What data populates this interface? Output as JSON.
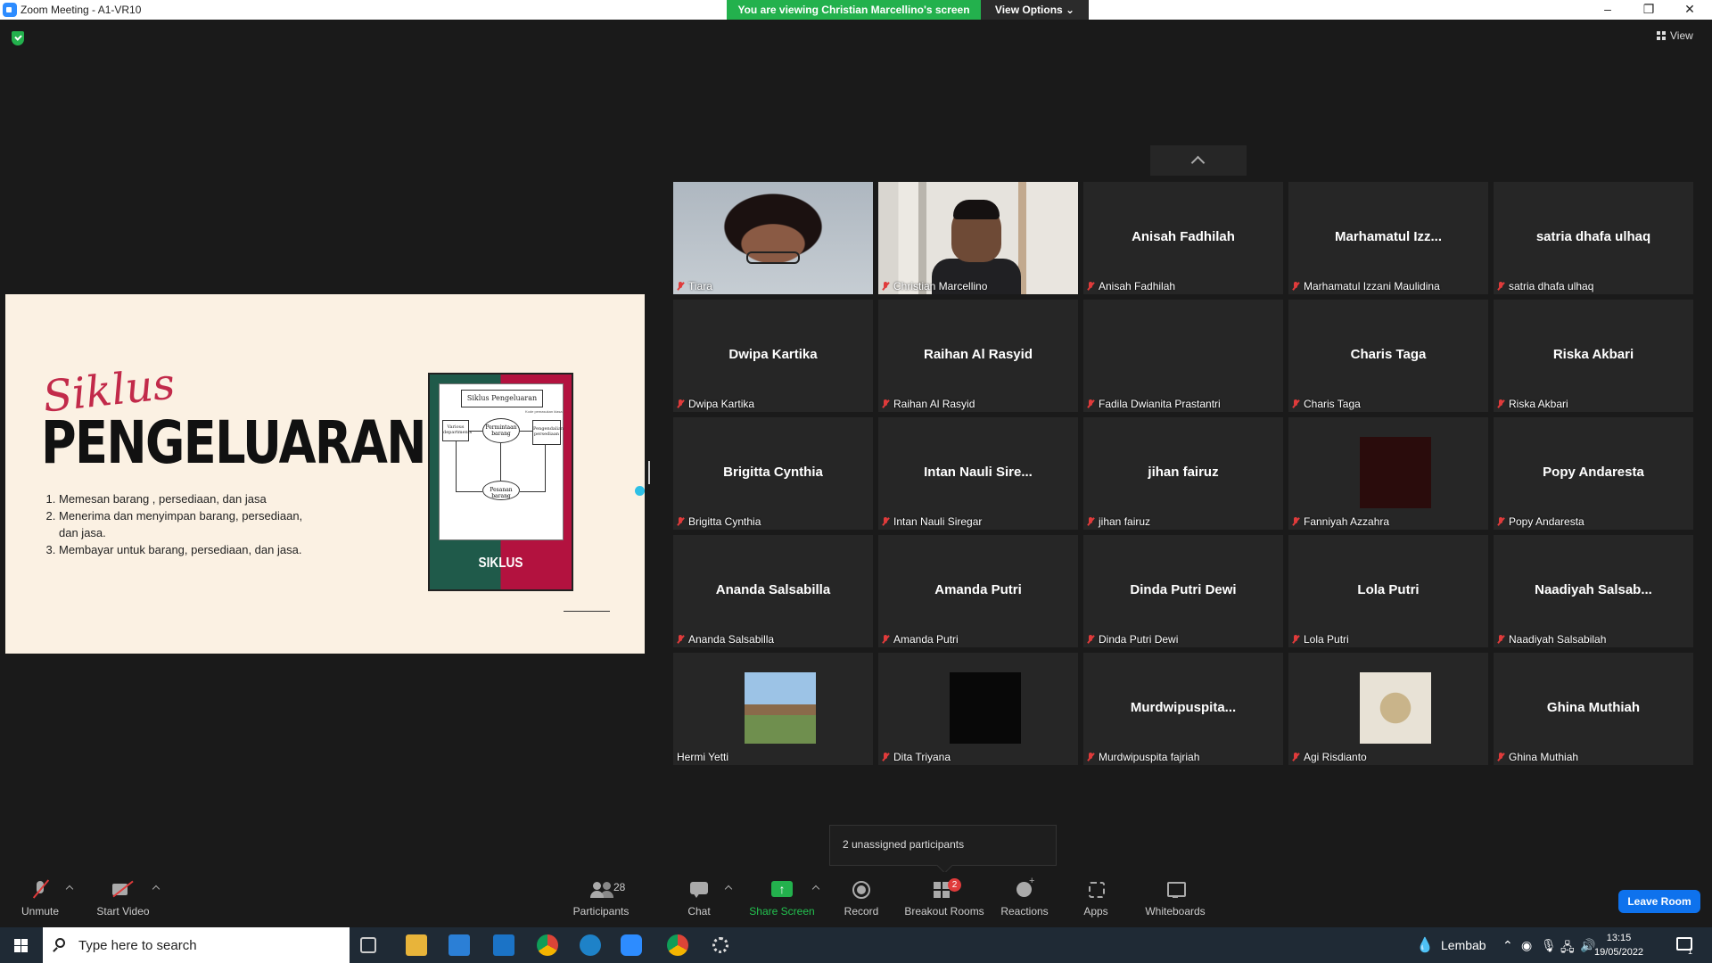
{
  "window": {
    "title": "Zoom Meeting - A1-VR10",
    "share_banner": "You are viewing Christian Marcellino's screen",
    "view_options": "View Options ⌄",
    "controls": [
      "–",
      "❐",
      "✕"
    ]
  },
  "top_right": {
    "view_label": "View"
  },
  "slide": {
    "script_title": "Siklus",
    "main_title": "PENGELUARAN",
    "items": [
      "Memesan barang , persediaan, dan jasa",
      "Menerima dan menyimpan barang, persediaan, dan jasa.",
      "Membayar untuk barang, persediaan, dan jasa."
    ],
    "book": {
      "diagram_title": "Siklus Pengeluaran",
      "diagram_subtitle": "Kode pemasukan klasa",
      "box_left": "Various departments",
      "oval_center": "Permintaan barang",
      "box_right": "Pengendalian persediaan",
      "oval_bottom": "Pesanan barang",
      "cover_word": "SIKLUS"
    }
  },
  "participants": [
    {
      "display": "",
      "label": "Tiara",
      "muted": true,
      "kind": "video-tiara"
    },
    {
      "display": "",
      "label": "Christian Marcellino",
      "muted": true,
      "kind": "video-christian"
    },
    {
      "display": "Anisah Fadhilah",
      "label": "Anisah Fadhilah",
      "muted": true
    },
    {
      "display": "Marhamatul  Izz...",
      "label": "Marhamatul Izzani Maulidina",
      "muted": true
    },
    {
      "display": "satria dhafa ulhaq",
      "label": "satria dhafa ulhaq",
      "muted": true
    },
    {
      "display": "Dwipa Kartika",
      "label": "Dwipa Kartika",
      "muted": true
    },
    {
      "display": "Raihan Al Rasyid",
      "label": "Raihan Al Rasyid",
      "muted": true
    },
    {
      "display": "",
      "label": "Fadila Dwianita Prastantri",
      "muted": true
    },
    {
      "display": "Charis Taga",
      "label": "Charis Taga",
      "muted": true
    },
    {
      "display": "Riska Akbari",
      "label": "Riska Akbari",
      "muted": true
    },
    {
      "display": "Brigitta Cynthia",
      "label": "Brigitta Cynthia",
      "muted": true
    },
    {
      "display": "Intan  Nauli  Sire...",
      "label": "Intan Nauli Siregar",
      "muted": true
    },
    {
      "display": "jihan fairuz",
      "label": "jihan fairuz",
      "muted": true
    },
    {
      "display": "",
      "label": "Fanniyah Azzahra",
      "muted": true,
      "kind": "avatar-dark-red"
    },
    {
      "display": "Popy Andaresta",
      "label": "Popy Andaresta",
      "muted": true
    },
    {
      "display": "Ananda Salsabilla",
      "label": "Ananda Salsabilla",
      "muted": true
    },
    {
      "display": "Amanda Putri",
      "label": "Amanda Putri",
      "muted": true
    },
    {
      "display": "Dinda Putri Dewi",
      "label": "Dinda Putri Dewi",
      "muted": true
    },
    {
      "display": "Lola Putri",
      "label": "Lola Putri",
      "muted": true
    },
    {
      "display": "Naadiyah  Salsab...",
      "label": "Naadiyah Salsabilah",
      "muted": true
    },
    {
      "display": "",
      "label": "Hermi Yetti",
      "muted": false,
      "kind": "avatar-photo-temple"
    },
    {
      "display": "",
      "label": "Dita Triyana",
      "muted": true,
      "kind": "avatar-black"
    },
    {
      "display": "Murdwipuspita...",
      "label": "Murdwipuspita fajriah",
      "muted": true
    },
    {
      "display": "",
      "label": "Agi Risdianto",
      "muted": true,
      "kind": "avatar-photo-flowers"
    },
    {
      "display": "Ghina Muthiah",
      "label": "Ghina Muthiah",
      "muted": true
    }
  ],
  "tooltip": "2 unassigned participants",
  "toolbar": {
    "unmute": "Unmute",
    "start_video": "Start Video",
    "participants_count": "28",
    "participants": "Participants",
    "chat": "Chat",
    "share_screen": "Share Screen",
    "record": "Record",
    "breakout_rooms": "Breakout Rooms",
    "breakout_badge": "2",
    "reactions": "Reactions",
    "apps": "Apps",
    "whiteboards": "Whiteboards",
    "leave": "Leave Room"
  },
  "taskbar": {
    "search_placeholder": "Type here to search",
    "weather": "Lembab",
    "time": "13:15",
    "date": "19/05/2022",
    "notif_count": "1"
  }
}
